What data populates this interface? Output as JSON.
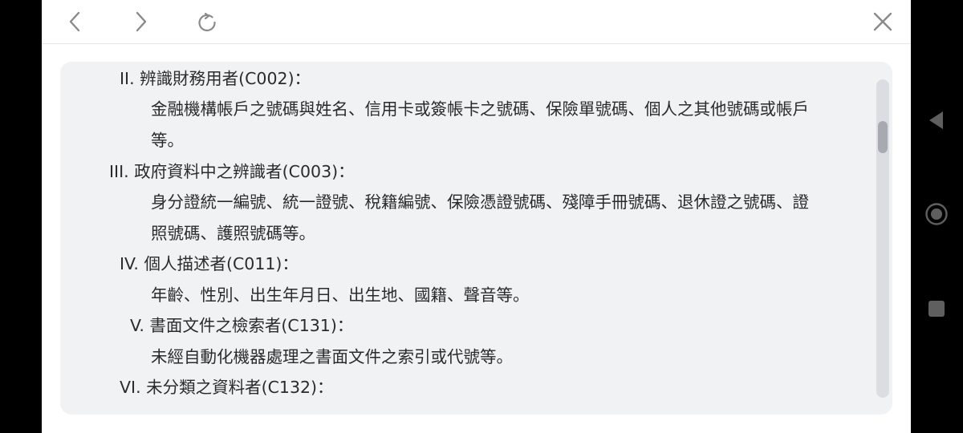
{
  "toolbar": {
    "back_icon": "chevron-left-icon",
    "forward_icon": "chevron-right-icon",
    "reload_icon": "reload-icon",
    "close_icon": "close-icon"
  },
  "content": {
    "lines": [
      "II. 辨識財務用者(C002)：",
      "金融機構帳戶之號碼與姓名、信用卡或簽帳卡之號碼、保險單號碼、個人之其他號碼或帳戶",
      "等。",
      "III. 政府資料中之辨識者(C003)：",
      "身分證統一編號、統一證號、稅籍編號、保險憑證號碼、殘障手冊號碼、退休證之號碼、證",
      "照號碼、護照號碼等。",
      "IV. 個人描述者(C011)：",
      "年齡、性別、出生年月日、出生地、國籍、聲音等。",
      "V. 書面文件之檢索者(C131)：",
      "未經自動化機器處理之書面文件之索引或代號等。",
      "VI. 未分類之資料者(C132)："
    ]
  },
  "navbar": {
    "back_icon": "triangle-back-icon",
    "home_icon": "circle-home-icon",
    "recents_icon": "square-recents-icon"
  },
  "colors": {
    "card_bg": "#f1f2f4",
    "text": "#2b2b2b",
    "icon": "#8a8a8a"
  }
}
